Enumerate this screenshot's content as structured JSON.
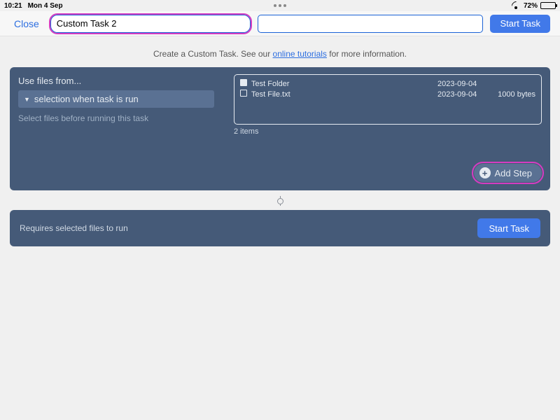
{
  "status": {
    "time": "10:21",
    "date": "Mon 4 Sep",
    "battery_pct": "72%"
  },
  "nav": {
    "close": "Close",
    "task_name": "Custom Task 2",
    "start": "Start Task"
  },
  "info": {
    "prefix": "Create a Custom Task. See our ",
    "link": "online tutorials",
    "suffix": " for more information."
  },
  "panel": {
    "title": "Use files from...",
    "dropdown": "selection when task is run",
    "hint": "Select files before running this task",
    "files": [
      {
        "name": "Test Folder",
        "date": "2023-09-04",
        "size": "",
        "kind": "folder"
      },
      {
        "name": "Test File.txt",
        "date": "2023-09-04",
        "size": "1000 bytes",
        "kind": "file"
      }
    ],
    "count": "2 items",
    "add_step": "Add Step"
  },
  "footer": {
    "text": "Requires selected files to run",
    "start": "Start Task"
  }
}
